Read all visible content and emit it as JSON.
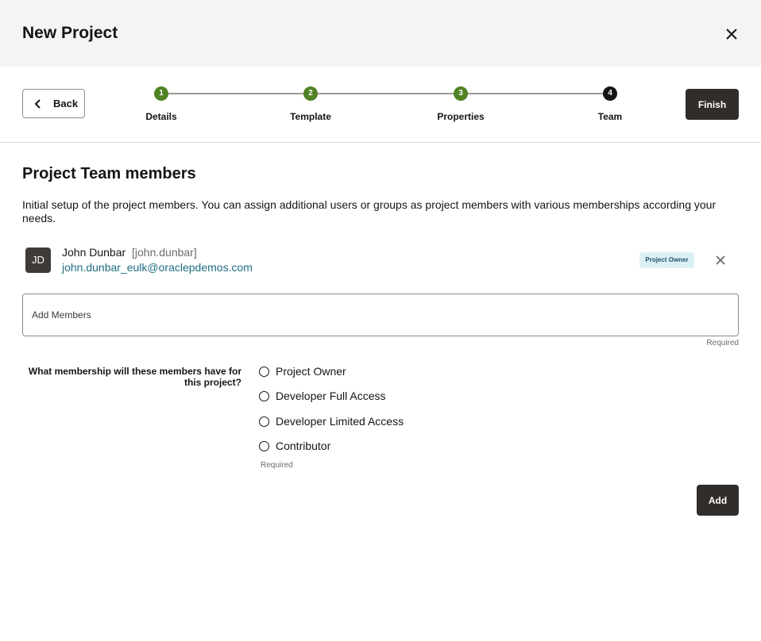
{
  "dialog": {
    "title": "New Project",
    "close_icon": "close-icon"
  },
  "toolbar": {
    "back_label": "Back",
    "finish_label": "Finish",
    "steps": [
      {
        "number": "1",
        "label": "Details",
        "state": "completed"
      },
      {
        "number": "2",
        "label": "Template",
        "state": "completed"
      },
      {
        "number": "3",
        "label": "Properties",
        "state": "completed"
      },
      {
        "number": "4",
        "label": "Team",
        "state": "current"
      }
    ]
  },
  "content": {
    "title": "Project Team members",
    "description": "Initial setup of the project members. You can assign additional users or groups as project members with various memberships according your needs."
  },
  "member": {
    "initials": "JD",
    "name": "John Dunbar",
    "username": "[john.dunbar]",
    "email": "john.dunbar_eulk@oraclepdemos.com",
    "role_badge": "Project Owner"
  },
  "add_members": {
    "placeholder": "Add Members",
    "required_text": "Required"
  },
  "membership": {
    "question": "What membership will these members have for this project?",
    "options": [
      "Project Owner",
      "Developer Full Access",
      "Developer Limited Access",
      "Contributor"
    ],
    "required_text": "Required",
    "add_label": "Add"
  },
  "colors": {
    "step_completed": "#508223",
    "step_current": "#161513",
    "primary_button": "#312d2a",
    "link": "#1f6d84",
    "badge_bg": "#dcf1f5"
  }
}
